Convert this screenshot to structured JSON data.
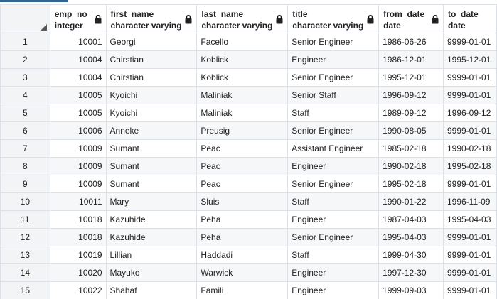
{
  "columns": [
    {
      "name": "emp_no",
      "type": "integer"
    },
    {
      "name": "first_name",
      "type": "character varying"
    },
    {
      "name": "last_name",
      "type": "character varying"
    },
    {
      "name": "title",
      "type": "character varying"
    },
    {
      "name": "from_date",
      "type": "date"
    },
    {
      "name": "to_date",
      "type": "date"
    }
  ],
  "rows": [
    {
      "n": "1",
      "emp_no": "10001",
      "first_name": "Georgi",
      "last_name": "Facello",
      "title": "Senior Engineer",
      "from_date": "1986-06-26",
      "to_date": "9999-01-01"
    },
    {
      "n": "2",
      "emp_no": "10004",
      "first_name": "Chirstian",
      "last_name": "Koblick",
      "title": "Engineer",
      "from_date": "1986-12-01",
      "to_date": "1995-12-01"
    },
    {
      "n": "3",
      "emp_no": "10004",
      "first_name": "Chirstian",
      "last_name": "Koblick",
      "title": "Senior Engineer",
      "from_date": "1995-12-01",
      "to_date": "9999-01-01"
    },
    {
      "n": "4",
      "emp_no": "10005",
      "first_name": "Kyoichi",
      "last_name": "Maliniak",
      "title": "Senior Staff",
      "from_date": "1996-09-12",
      "to_date": "9999-01-01"
    },
    {
      "n": "5",
      "emp_no": "10005",
      "first_name": "Kyoichi",
      "last_name": "Maliniak",
      "title": "Staff",
      "from_date": "1989-09-12",
      "to_date": "1996-09-12"
    },
    {
      "n": "6",
      "emp_no": "10006",
      "first_name": "Anneke",
      "last_name": "Preusig",
      "title": "Senior Engineer",
      "from_date": "1990-08-05",
      "to_date": "9999-01-01"
    },
    {
      "n": "7",
      "emp_no": "10009",
      "first_name": "Sumant",
      "last_name": "Peac",
      "title": "Assistant Engineer",
      "from_date": "1985-02-18",
      "to_date": "1990-02-18"
    },
    {
      "n": "8",
      "emp_no": "10009",
      "first_name": "Sumant",
      "last_name": "Peac",
      "title": "Engineer",
      "from_date": "1990-02-18",
      "to_date": "1995-02-18"
    },
    {
      "n": "9",
      "emp_no": "10009",
      "first_name": "Sumant",
      "last_name": "Peac",
      "title": "Senior Engineer",
      "from_date": "1995-02-18",
      "to_date": "9999-01-01"
    },
    {
      "n": "10",
      "emp_no": "10011",
      "first_name": "Mary",
      "last_name": "Sluis",
      "title": "Staff",
      "from_date": "1990-01-22",
      "to_date": "1996-11-09"
    },
    {
      "n": "11",
      "emp_no": "10018",
      "first_name": "Kazuhide",
      "last_name": "Peha",
      "title": "Engineer",
      "from_date": "1987-04-03",
      "to_date": "1995-04-03"
    },
    {
      "n": "12",
      "emp_no": "10018",
      "first_name": "Kazuhide",
      "last_name": "Peha",
      "title": "Senior Engineer",
      "from_date": "1995-04-03",
      "to_date": "9999-01-01"
    },
    {
      "n": "13",
      "emp_no": "10019",
      "first_name": "Lillian",
      "last_name": "Haddadi",
      "title": "Staff",
      "from_date": "1999-04-30",
      "to_date": "9999-01-01"
    },
    {
      "n": "14",
      "emp_no": "10020",
      "first_name": "Mayuko",
      "last_name": "Warwick",
      "title": "Engineer",
      "from_date": "1997-12-30",
      "to_date": "9999-01-01"
    },
    {
      "n": "15",
      "emp_no": "10022",
      "first_name": "Shahaf",
      "last_name": "Famili",
      "title": "Engineer",
      "from_date": "1999-09-03",
      "to_date": "9999-01-01"
    }
  ]
}
